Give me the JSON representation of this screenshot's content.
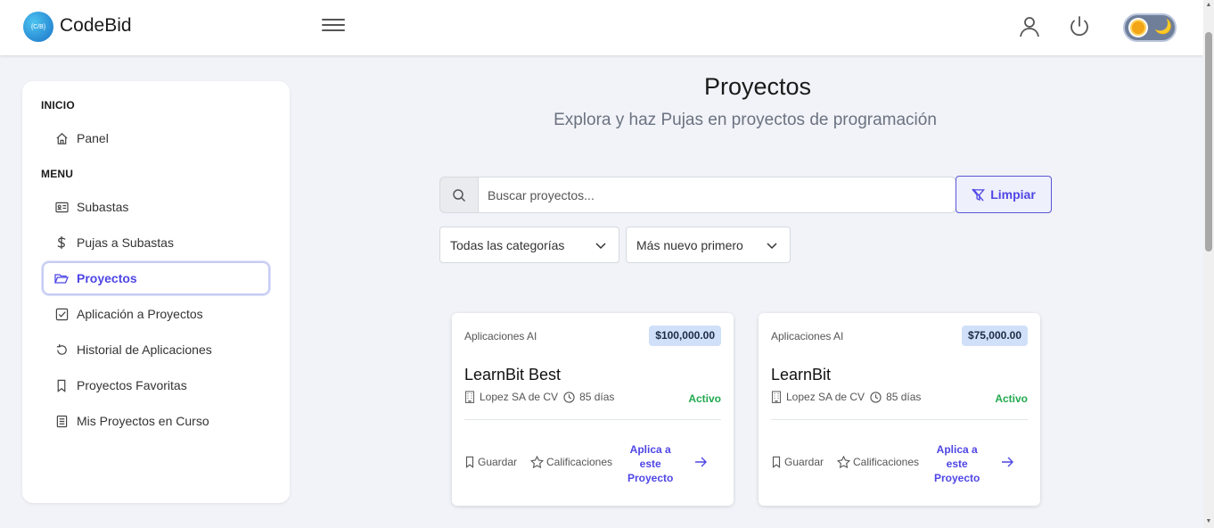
{
  "app": {
    "brand": "CodeBid",
    "logo_text": "{C/B}"
  },
  "navbar": {
    "icons": [
      "menu-icon",
      "user-icon",
      "power-icon",
      "theme-toggle"
    ],
    "theme_icons": {
      "sun": "sun-icon",
      "moon": "🌙"
    }
  },
  "sidebar": {
    "sections": [
      {
        "title": "INICIO",
        "items": [
          {
            "label": "Panel",
            "icon": "home-icon"
          }
        ]
      },
      {
        "title": "MENU",
        "items": [
          {
            "label": "Subastas",
            "icon": "id-card-icon"
          },
          {
            "label": "Pujas a Subastas",
            "icon": "dollar-icon"
          },
          {
            "label": "Proyectos",
            "icon": "folder-open-icon",
            "active": true
          },
          {
            "label": "Aplicación a Proyectos",
            "icon": "check-square-icon"
          },
          {
            "label": "Historial de Aplicaciones",
            "icon": "history-icon"
          },
          {
            "label": "Proyectos Favoritas",
            "icon": "bookmark-icon"
          },
          {
            "label": "Mis Proyectos en Curso",
            "icon": "document-list-icon"
          }
        ]
      }
    ]
  },
  "main": {
    "title": "Proyectos",
    "subtitle": "Explora y haz Pujas en proyectos de programación",
    "search": {
      "placeholder": "Buscar proyectos...",
      "value": ""
    },
    "clear_label": "Limpiar",
    "filters": {
      "category": "Todas las categorías",
      "sort": "Más nuevo primero"
    },
    "accent_color": "#4f46e5",
    "status_color": "#22a94f"
  },
  "cards": [
    {
      "category": "Aplicaciones AI",
      "price": "$100,000.00",
      "title": "LearnBit Best",
      "company": "Lopez SA de CV",
      "duration": "85 días",
      "status": "Activo",
      "save_label": "Guardar",
      "rate_label": "Calificaciones",
      "apply_lines": [
        "Aplica a",
        "este",
        "Proyecto"
      ]
    },
    {
      "category": "Aplicaciones AI",
      "price": "$75,000.00",
      "title": "LearnBit",
      "company": "Lopez SA de CV",
      "duration": "85 días",
      "status": "Activo",
      "save_label": "Guardar",
      "rate_label": "Calificaciones",
      "apply_lines": [
        "Aplica a",
        "este",
        "Proyecto"
      ]
    }
  ]
}
